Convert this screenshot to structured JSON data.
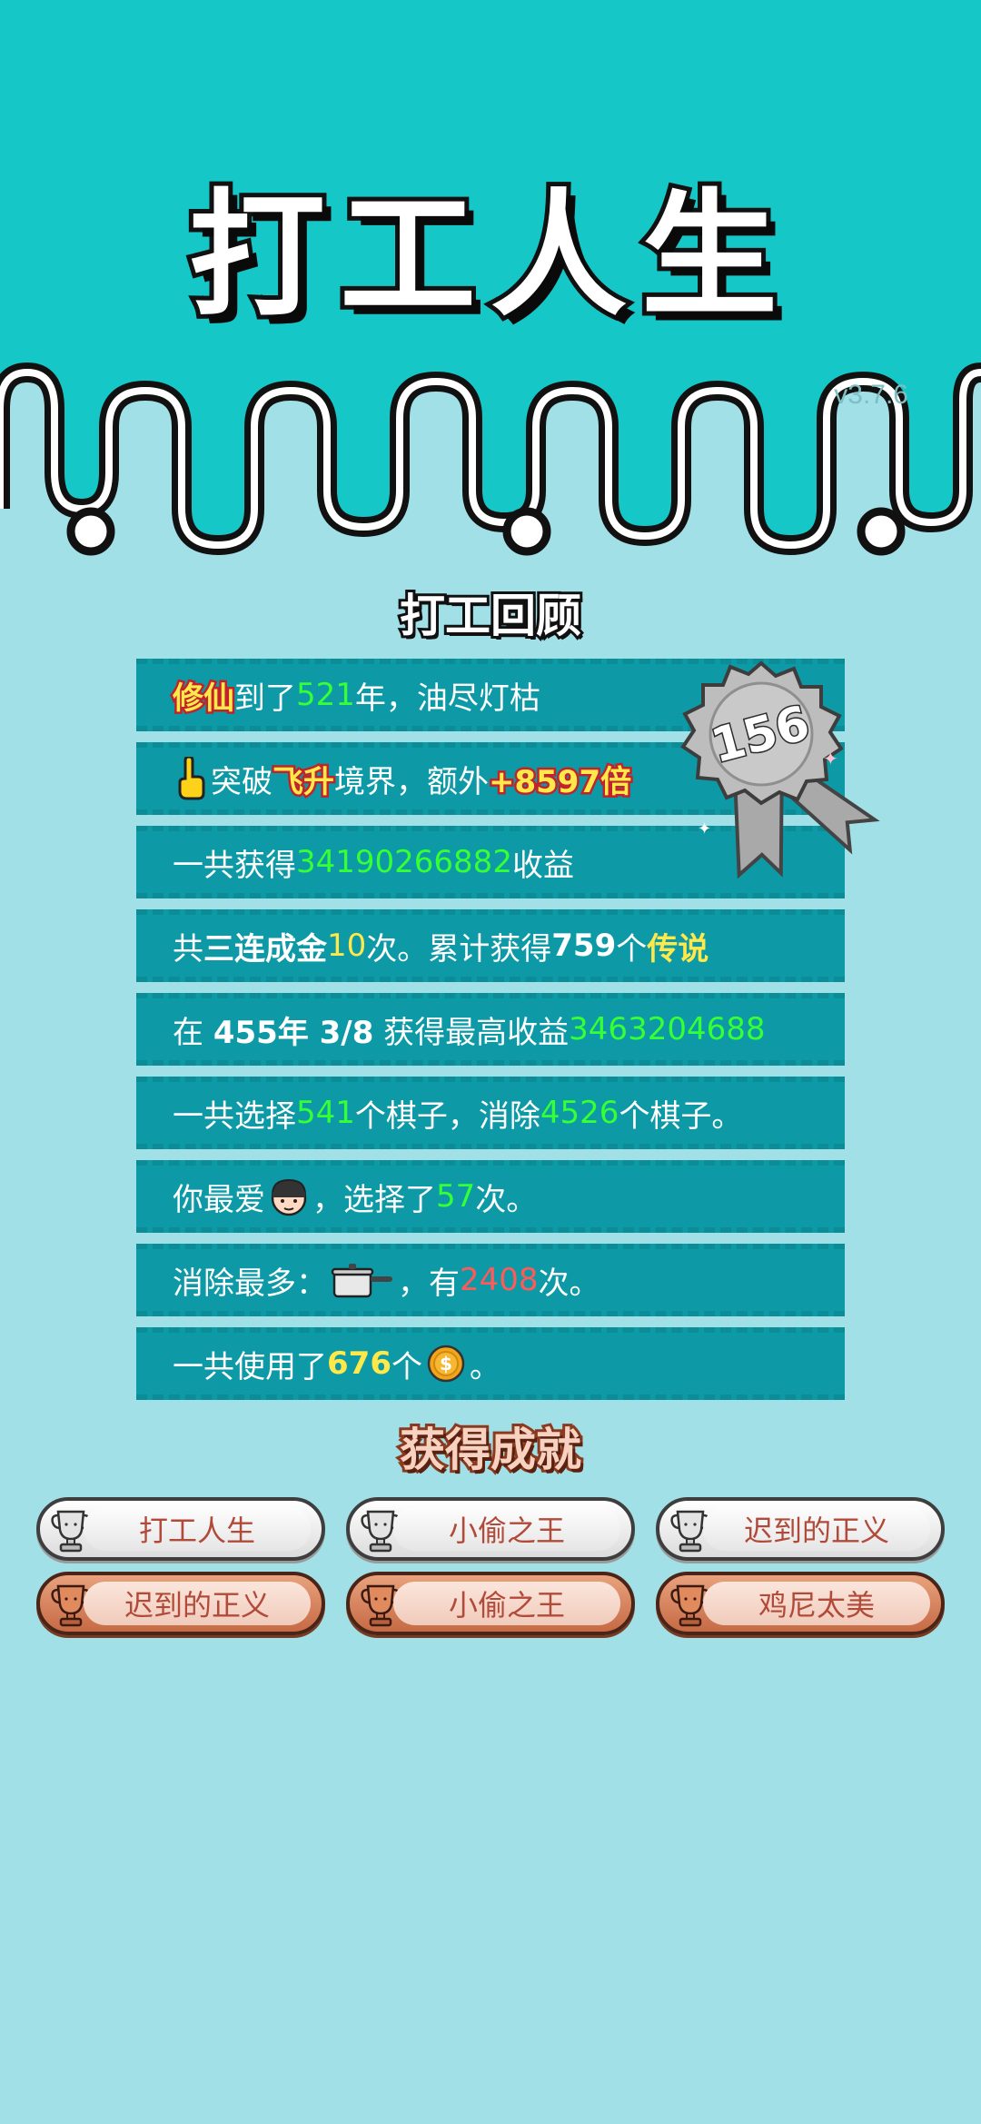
{
  "app": {
    "title": "打工人生",
    "version": "v3.7.6"
  },
  "review": {
    "title": "打工回顾",
    "badge_number": "156",
    "rows": [
      {
        "parts": [
          "修仙",
          "到了",
          "521",
          "年，油尽灯枯"
        ]
      },
      {
        "parts": [
          "突破",
          "飞升",
          "境界，额外",
          "+8597倍"
        ]
      },
      {
        "parts": [
          "一共获得",
          "34190266882",
          "收益"
        ]
      },
      {
        "parts": [
          "共",
          "三连成金",
          "10",
          "次。累计获得",
          "759",
          "个",
          "传说"
        ]
      },
      {
        "parts": [
          "在 ",
          "455年 3/8",
          " 获得最高收益",
          "3463204688"
        ]
      },
      {
        "parts": [
          "一共选择",
          "541",
          "个棋子，消除",
          "4526",
          "个棋子。"
        ]
      },
      {
        "parts": [
          "你最爱",
          "，选择了",
          "57",
          "次。"
        ]
      },
      {
        "parts": [
          "消除最多：",
          "，有",
          "2408",
          "次。"
        ]
      },
      {
        "parts": [
          "一共使用了",
          "676",
          "个",
          "。"
        ]
      }
    ],
    "icons": {
      "row2": "pointing-hand-icon",
      "row7": "thief-face-icon",
      "row8": "cooking-pot-icon",
      "row9": "gold-coin-icon"
    }
  },
  "achievements": {
    "title": "获得成就",
    "items": [
      {
        "label": "打工人生",
        "tier": "silver"
      },
      {
        "label": "小偷之王",
        "tier": "silver"
      },
      {
        "label": "迟到的正义",
        "tier": "silver"
      },
      {
        "label": "迟到的正义",
        "tier": "bronze"
      },
      {
        "label": "小偷之王",
        "tier": "bronze"
      },
      {
        "label": "鸡尼太美",
        "tier": "bronze"
      }
    ]
  },
  "colors": {
    "header_teal": "#16c7c8",
    "background": "#a2e0e7",
    "row_teal": "#0d9aa6",
    "value_green": "#35ff35",
    "value_yellow": "#ffe94a",
    "value_red": "#ff5a5a"
  }
}
